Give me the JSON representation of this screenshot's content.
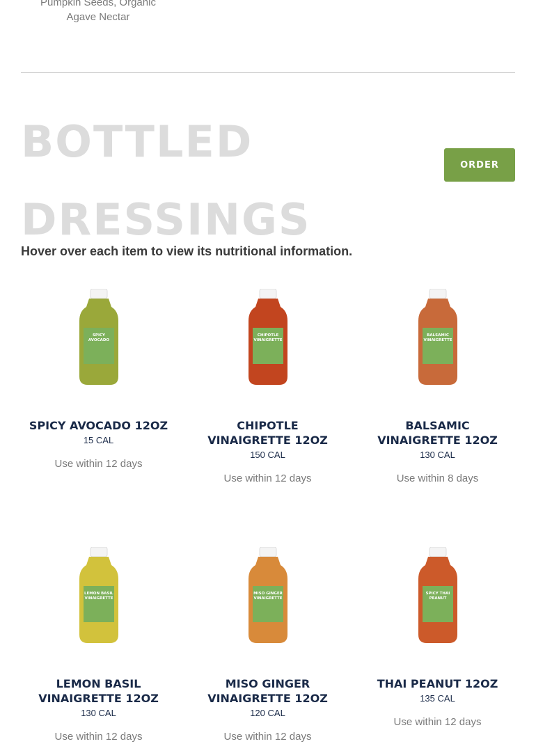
{
  "previous_item": {
    "ingredients_line1": "Pumpkin Seeds, Organic",
    "ingredients_line2": "Agave Nectar"
  },
  "section": {
    "title": "BOTTLED DRESSINGS",
    "order_label": "ORDER",
    "hint": "Hover over each item to view its nutritional information."
  },
  "colors": {
    "accent": "#78a047",
    "title_gray": "#dcdcdc",
    "product_name": "#1a2a48"
  },
  "products": [
    {
      "name": "SPICY AVOCADO 12OZ",
      "calories": "15 CAL",
      "use": "Use within 12 days",
      "bottle_color": "#9aa83a",
      "label_text": "SPICY AVOCADO"
    },
    {
      "name": "CHIPOTLE VINAIGRETTE 12OZ",
      "calories": "150 CAL",
      "use": "Use within 12 days",
      "bottle_color": "#c2451f",
      "label_text": "CHIPOTLE VINAIGRETTE"
    },
    {
      "name": "BALSAMIC VINAIGRETTE 12OZ",
      "calories": "130 CAL",
      "use": "Use within 8 days",
      "bottle_color": "#c86a3a",
      "label_text": "BALSAMIC VINAIGRETTE"
    },
    {
      "name": "LEMON BASIL VINAIGRETTE 12OZ",
      "calories": "130 CAL",
      "use": "Use within 12 days",
      "bottle_color": "#d2c23c",
      "label_text": "LEMON BASIL VINAIGRETTE"
    },
    {
      "name": "MISO GINGER VINAIGRETTE 12OZ",
      "calories": "120 CAL",
      "use": "Use within 12 days",
      "bottle_color": "#d88a3a",
      "label_text": "MISO GINGER VINAIGRETTE"
    },
    {
      "name": "THAI PEANUT 12OZ",
      "calories": "135 CAL",
      "use": "Use within 12 days",
      "bottle_color": "#cc5a2a",
      "label_text": "SPICY THAI PEANUT"
    }
  ]
}
